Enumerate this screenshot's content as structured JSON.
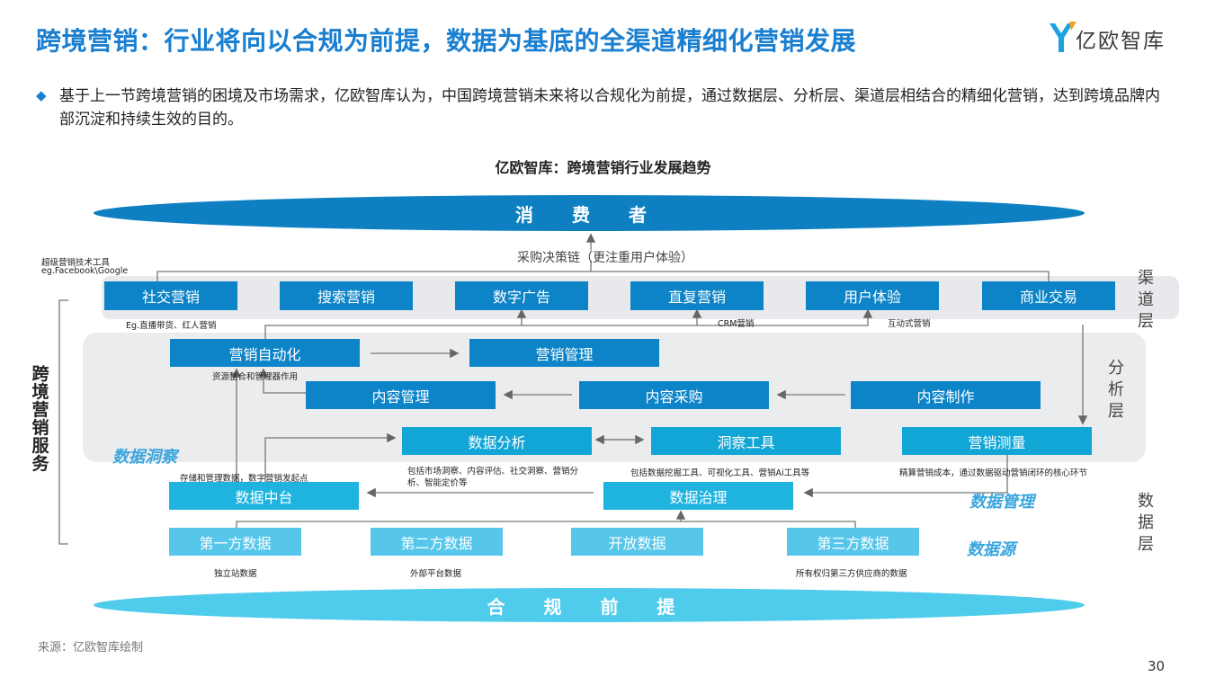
{
  "header": {
    "title": "跨境营销：行业将向以合规为前提，数据为基底的全渠道精细化营销发展",
    "logo_text": "亿欧智库",
    "brand_color": "#1a7fd0"
  },
  "description": "基于上一节跨境营销的困境及市场需求，亿欧智库认为，中国跨境营销未来将以合规化为前提，通过数据层、分析层、渠道层相结合的精细化营销，达到跨境品牌内部沉淀和持续生效的目的。",
  "diagram": {
    "subtitle": "亿欧智库：跨境营销行业发展趋势",
    "top_ellipse": "消 费 者",
    "bottom_ellipse": "合 规 前 提",
    "purchase_chain": "采购决策链（更注重用户体验）",
    "super_tools": "超级营销技术工具",
    "super_tools_eg": "eg.Facebook\\Google",
    "service_label": "跨境营销服务",
    "layers": {
      "channel": "渠道层",
      "analysis": "分析层",
      "data": "数据层"
    },
    "channel_boxes": [
      "社交营销",
      "搜索营销",
      "数字广告",
      "直复营销",
      "用户体验",
      "商业交易"
    ],
    "channel_notes": {
      "social": "Eg.直播带货、红人营销",
      "crm": "CRM营销",
      "interactive": "互动式营销"
    },
    "analysis_boxes": {
      "automation": "营销自动化",
      "management": "营销管理",
      "content_mgmt": "内容管理",
      "content_purchase": "内容采购",
      "content_make": "内容制作",
      "data_analysis": "数据分析",
      "insight_tools": "洞察工具",
      "measurement": "营销测量"
    },
    "analysis_notes": {
      "resource": "资源整合和管理器作用",
      "storage": "存储和管理数据，数字营销发起点",
      "market_insight": "包括市场洞察、内容评估、社交洞察、营销分析、智能定价等",
      "mining_tools": "包括数据挖掘工具、可视化工具、营销Ai工具等",
      "precise_cost": "精算营销成本，通过数据驱动营销闭环的核心环节"
    },
    "italic_labels": {
      "insight": "数据洞察",
      "management": "数据管理",
      "source": "数据源"
    },
    "data_boxes": {
      "platform": "数据中台",
      "governance": "数据治理"
    },
    "source_boxes": [
      "第一方数据",
      "第二方数据",
      "开放数据",
      "第三方数据"
    ],
    "source_notes": [
      "独立站数据",
      "外部平台数据",
      "所有权归第三方供应商的数据"
    ]
  },
  "footer": {
    "source": "来源：亿欧智库绘制",
    "page": "30"
  },
  "colors": {
    "dark_box": "#0d84c7",
    "mid_box": "#12a6d6",
    "light_box": "#56c6ea",
    "ellipse_top": "#0e80c2",
    "ellipse_bottom": "#4fcbec"
  }
}
